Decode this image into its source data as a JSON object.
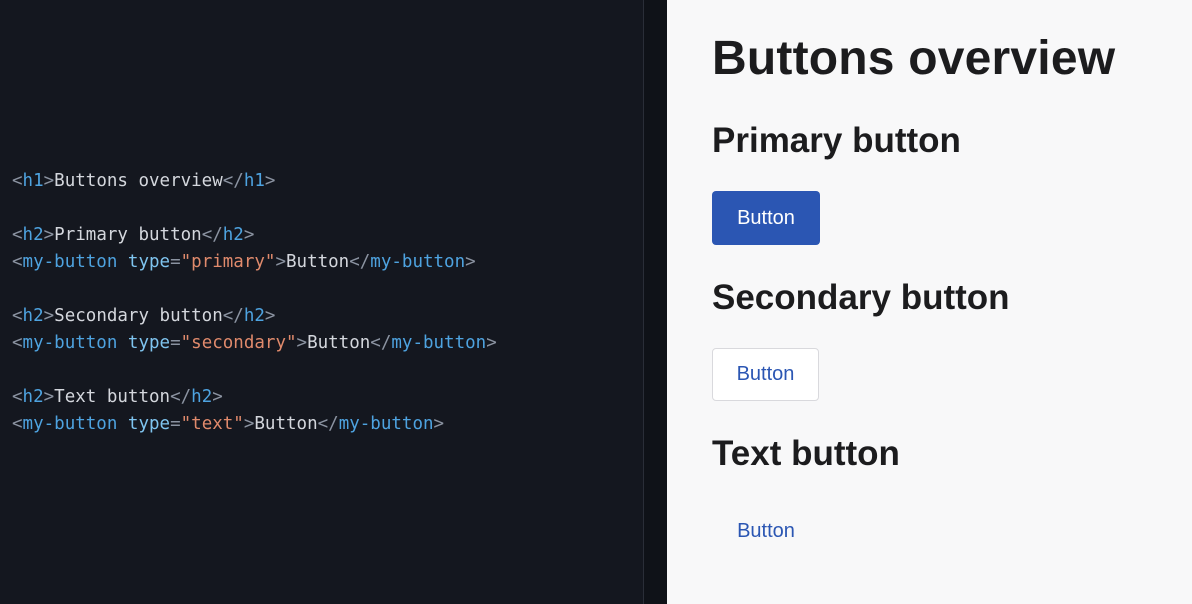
{
  "code": {
    "lines": [
      [
        [
          "punct",
          "<"
        ],
        [
          "tag",
          "h1"
        ],
        [
          "punct",
          ">"
        ],
        [
          "text",
          "Buttons overview"
        ],
        [
          "punct",
          "</"
        ],
        [
          "tag",
          "h1"
        ],
        [
          "punct",
          ">"
        ]
      ],
      [],
      [
        [
          "punct",
          "<"
        ],
        [
          "tag",
          "h2"
        ],
        [
          "punct",
          ">"
        ],
        [
          "text",
          "Primary button"
        ],
        [
          "punct",
          "</"
        ],
        [
          "tag",
          "h2"
        ],
        [
          "punct",
          ">"
        ]
      ],
      [
        [
          "punct",
          "<"
        ],
        [
          "tag",
          "my-button"
        ],
        [
          "text",
          " "
        ],
        [
          "attr",
          "type"
        ],
        [
          "punct",
          "="
        ],
        [
          "str",
          "\"primary\""
        ],
        [
          "punct",
          ">"
        ],
        [
          "text",
          "Button"
        ],
        [
          "punct",
          "</"
        ],
        [
          "tag",
          "my-button"
        ],
        [
          "punct",
          ">"
        ]
      ],
      [],
      [
        [
          "punct",
          "<"
        ],
        [
          "tag",
          "h2"
        ],
        [
          "punct",
          ">"
        ],
        [
          "text",
          "Secondary button"
        ],
        [
          "punct",
          "</"
        ],
        [
          "tag",
          "h2"
        ],
        [
          "punct",
          ">"
        ]
      ],
      [
        [
          "punct",
          "<"
        ],
        [
          "tag",
          "my-button"
        ],
        [
          "text",
          " "
        ],
        [
          "attr",
          "type"
        ],
        [
          "punct",
          "="
        ],
        [
          "str",
          "\"secondary\""
        ],
        [
          "punct",
          ">"
        ],
        [
          "text",
          "Button"
        ],
        [
          "punct",
          "</"
        ],
        [
          "tag",
          "my-button"
        ],
        [
          "punct",
          ">"
        ]
      ],
      [],
      [
        [
          "punct",
          "<"
        ],
        [
          "tag",
          "h2"
        ],
        [
          "punct",
          ">"
        ],
        [
          "text",
          "Text button"
        ],
        [
          "punct",
          "</"
        ],
        [
          "tag",
          "h2"
        ],
        [
          "punct",
          ">"
        ]
      ],
      [
        [
          "punct",
          "<"
        ],
        [
          "tag",
          "my-button"
        ],
        [
          "text",
          " "
        ],
        [
          "attr",
          "type"
        ],
        [
          "punct",
          "="
        ],
        [
          "str",
          "\"text\""
        ],
        [
          "punct",
          ">"
        ],
        [
          "text",
          "Button"
        ],
        [
          "punct",
          "</"
        ],
        [
          "tag",
          "my-button"
        ],
        [
          "punct",
          ">"
        ]
      ]
    ]
  },
  "preview": {
    "title": "Buttons overview",
    "primary_heading": "Primary button",
    "primary_button": "Button",
    "secondary_heading": "Secondary button",
    "secondary_button": "Button",
    "text_heading": "Text button",
    "text_button": "Button"
  },
  "colors": {
    "code_bg": "#14171f",
    "preview_bg": "#f8f8f9",
    "accent": "#2b56b3",
    "tag": "#4ea3e0",
    "attr": "#7fc4ef",
    "string": "#e08a6c"
  }
}
